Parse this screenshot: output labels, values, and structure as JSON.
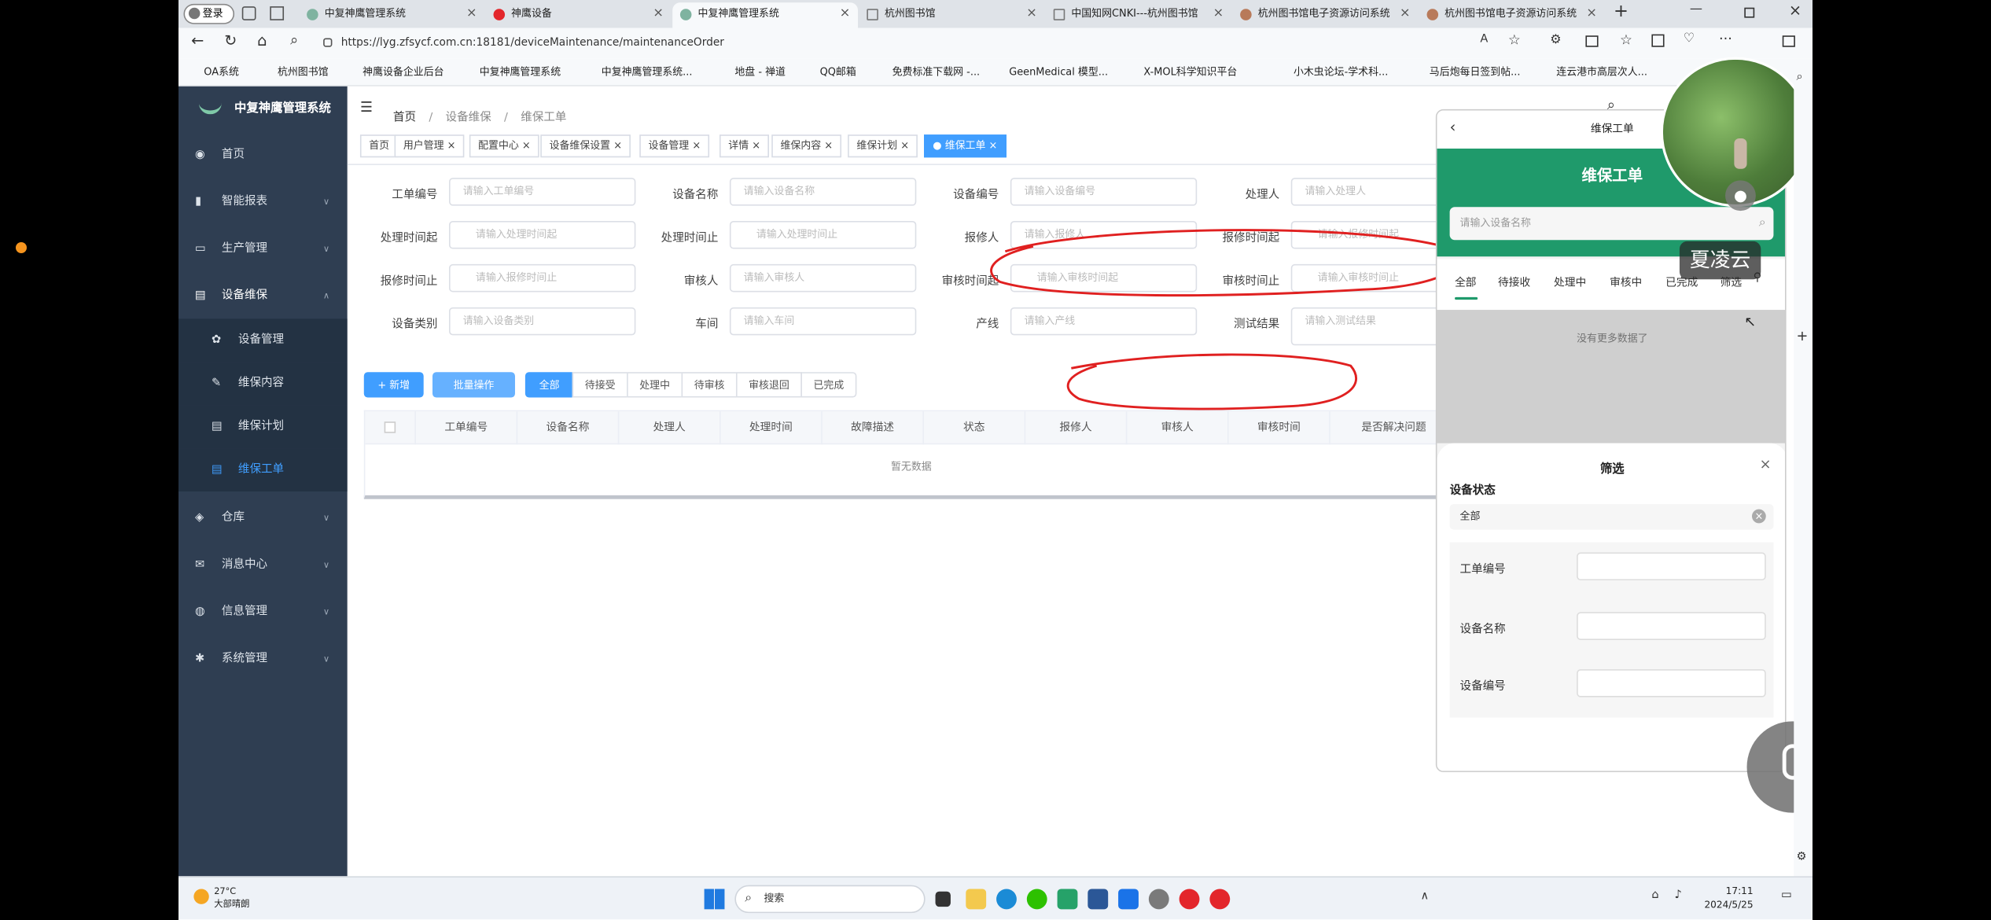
{
  "browser": {
    "profile": "登录",
    "tabs": [
      "中复神鹰管理系统",
      "神鹰设备",
      "中复神鹰管理系统",
      "杭州图书馆",
      "中国知网CNKI---杭州图书馆",
      "杭州图书馆电子资源访问系统",
      "杭州图书馆电子资源访问系统"
    ],
    "url": "https://lyg.zfsycf.com.cn:18181/deviceMaintenance/maintenanceOrder",
    "favorites": [
      "OA系统",
      "杭州图书馆",
      "神鹰设备企业后台",
      "中复神鹰管理系统",
      "中复神鹰管理系统...",
      "地盘 - 禅道",
      "QQ邮箱",
      "免费标准下载网 -...",
      "GeenMedical 模型...",
      "X-MOL科学知识平台",
      "小木虫论坛-学术科...",
      "马后炮每日签到帖...",
      "连云港市高层次人..."
    ]
  },
  "app": {
    "title": "中复神鹰管理系统",
    "menu": [
      {
        "label": "首页"
      },
      {
        "label": "智能报表"
      },
      {
        "label": "生产管理"
      },
      {
        "label": "设备维保"
      },
      {
        "label": "设备管理"
      },
      {
        "label": "维保内容"
      },
      {
        "label": "维保计划"
      },
      {
        "label": "维保工单"
      },
      {
        "label": "仓库"
      },
      {
        "label": "消息中心"
      },
      {
        "label": "信息管理"
      },
      {
        "label": "系统管理"
      }
    ],
    "breadcrumb": [
      "首页",
      "设备维保",
      "维保工单"
    ],
    "tags": [
      "首页",
      "用户管理",
      "配置中心",
      "设备维保设置",
      "设备管理",
      "详情",
      "维保内容",
      "维保计划",
      "维保工单"
    ],
    "form": {
      "labels": [
        "工单编号",
        "设备名称",
        "设备编号",
        "处理人",
        "处理时间起",
        "处理时间止",
        "报修人",
        "报修时间起",
        "报修时间止",
        "审核人",
        "审核时间起",
        "审核时间止",
        "设备类别",
        "车间",
        "产线",
        "测试结果"
      ],
      "placeholders": [
        "请输入工单编号",
        "请输入设备名称",
        "请输入设备编号",
        "请输入处理人",
        "请输入处理时间起",
        "请输入处理时间止",
        "请输入报修人",
        "请输入报修时间起",
        "请输入报修时间止",
        "请输入审核人",
        "请输入审核时间起",
        "请输入审核时间止",
        "请输入设备类别",
        "请输入车间",
        "请输入产线",
        "请输入测试结果"
      ]
    },
    "actions": {
      "add": "+ 新增",
      "batch": "批量操作"
    },
    "status_tabs": [
      "全部",
      "待接受",
      "处理中",
      "待审核",
      "审核退回",
      "已完成"
    ],
    "table": {
      "headers": [
        "工单编号",
        "设备名称",
        "处理人",
        "处理时间",
        "故障描述",
        "状态",
        "报修人",
        "审核人",
        "审核时间",
        "是否解决问题"
      ],
      "empty": "暂无数据"
    }
  },
  "mobile": {
    "nav_title": "维保工单",
    "banner": "维保工单",
    "search_placeholder": "请输入设备名称",
    "watermark": "夏凌云",
    "tabs": [
      "全部",
      "待接收",
      "处理中",
      "审核中",
      "已完成",
      "筛选"
    ],
    "no_more": "没有更多数据了",
    "filter": {
      "title": "筛选",
      "section": "设备状态",
      "status_value": "全部",
      "fields": [
        "工单编号",
        "设备名称",
        "设备编号"
      ]
    }
  },
  "taskbar": {
    "weather_temp": "27°C",
    "weather_desc": "大部晴朗",
    "search": "搜索",
    "time": "17:11",
    "date": "2024/5/25"
  }
}
